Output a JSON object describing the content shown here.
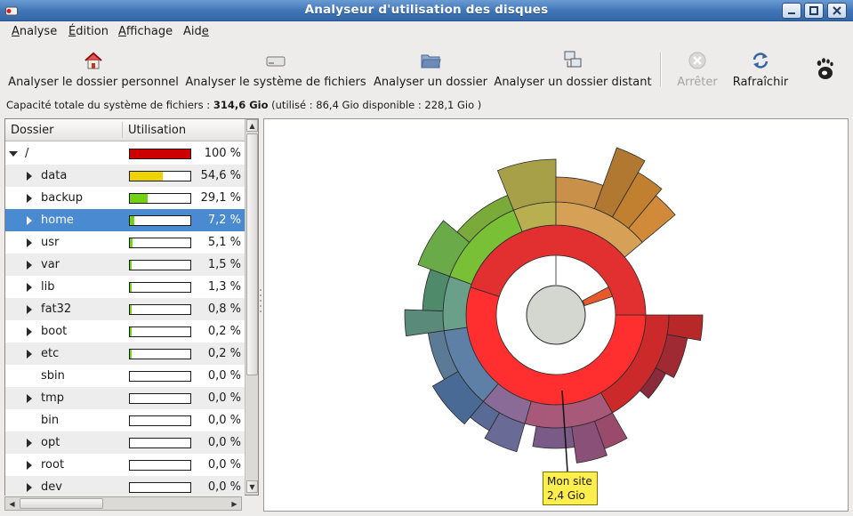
{
  "window": {
    "title": "Analyseur d'utilisation des disques"
  },
  "menubar": [
    {
      "label": "Analyse",
      "mnemonic": "A",
      "rest": "nalyse"
    },
    {
      "label": "Édition",
      "mnemonic": "É",
      "rest": "dition"
    },
    {
      "label": "Affichage",
      "mnemonic": "A",
      "rest": "ffichage"
    },
    {
      "label": "Aide",
      "pre": "Aid",
      "mnemonic": "e"
    }
  ],
  "toolbar": {
    "scan_home": "Analyser le dossier personnel",
    "scan_filesystem": "Analyser le système de fichiers",
    "scan_folder": "Analyser un dossier",
    "scan_remote": "Analyser un dossier distant",
    "stop": "Arrêter",
    "refresh": "Rafraîchir"
  },
  "capacity": {
    "prefix": "Capacité totale du système de fichiers : ",
    "total": "314,6 Gio",
    "suffix": " (utilisé : 86,4 Gio disponible : 228,1 Gio )"
  },
  "tree": {
    "col_folder": "Dossier",
    "col_usage": "Utilisation",
    "rows": [
      {
        "name": "/",
        "usage": 1.0,
        "pct": "100 %",
        "color": "#cc0000",
        "expanded": true,
        "depth": 0
      },
      {
        "name": "data",
        "usage": 0.546,
        "pct": "54,6 %",
        "color": "#edd400",
        "depth": 1
      },
      {
        "name": "backup",
        "usage": 0.291,
        "pct": "29,1 %",
        "color": "#73d216",
        "depth": 1
      },
      {
        "name": "home",
        "usage": 0.072,
        "pct": "7,2 %",
        "color": "#73d216",
        "depth": 1,
        "selected": true
      },
      {
        "name": "usr",
        "usage": 0.051,
        "pct": "5,1 %",
        "color": "#73d216",
        "depth": 1
      },
      {
        "name": "var",
        "usage": 0.015,
        "pct": "1,5 %",
        "color": "#73d216",
        "depth": 1
      },
      {
        "name": "lib",
        "usage": 0.013,
        "pct": "1,3 %",
        "color": "#73d216",
        "depth": 1
      },
      {
        "name": "fat32",
        "usage": 0.008,
        "pct": "0,8 %",
        "color": "#73d216",
        "depth": 1
      },
      {
        "name": "boot",
        "usage": 0.002,
        "pct": "0,2 %",
        "color": "#73d216",
        "depth": 1
      },
      {
        "name": "etc",
        "usage": 0.002,
        "pct": "0,2 %",
        "color": "#73d216",
        "depth": 1
      },
      {
        "name": "sbin",
        "usage": 0.0,
        "pct": "0,0 %",
        "color": "#73d216",
        "depth": 1,
        "leaf": true
      },
      {
        "name": "tmp",
        "usage": 0.0,
        "pct": "0,0 %",
        "color": "#73d216",
        "depth": 1
      },
      {
        "name": "bin",
        "usage": 0.0,
        "pct": "0,0 %",
        "color": "#73d216",
        "depth": 1,
        "leaf": true
      },
      {
        "name": "opt",
        "usage": 0.0,
        "pct": "0,0 %",
        "color": "#73d216",
        "depth": 1
      },
      {
        "name": "root",
        "usage": 0.0,
        "pct": "0,0 %",
        "color": "#73d216",
        "depth": 1
      },
      {
        "name": "dev",
        "usage": 0.0,
        "pct": "0,0 %",
        "color": "#73d216",
        "depth": 1
      }
    ]
  },
  "tooltip": {
    "line1": "Mon site",
    "line2": "2,4 Gio"
  },
  "colors": {
    "root_disk": "#d3d7cf",
    "data": "#e62727",
    "backup": "#ef3030",
    "accent_selection": "#4a8ad0"
  }
}
